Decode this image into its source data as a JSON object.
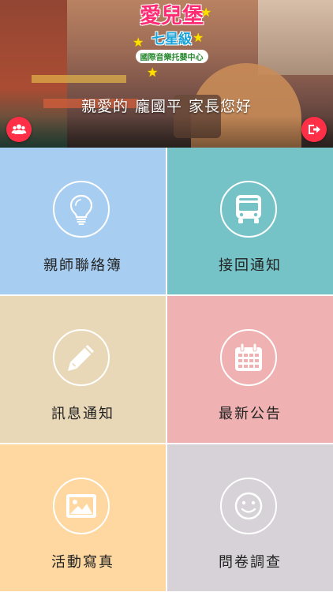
{
  "header": {
    "logo": {
      "title": "愛兒堡",
      "subtitle": "七星級",
      "tagline": "國際音樂托嬰中心"
    },
    "greeting": {
      "prefix": "親愛的",
      "name": "龐國平",
      "suffix": "家長您好"
    },
    "left_button_icon": "users-icon",
    "right_button_icon": "logout-icon"
  },
  "tiles": [
    {
      "label": "親師聯絡簿",
      "icon": "lightbulb-icon",
      "color": "#a7cdf1"
    },
    {
      "label": "接回通知",
      "icon": "bus-icon",
      "color": "#76c3c7"
    },
    {
      "label": "訊息通知",
      "icon": "pencil-icon",
      "color": "#e9d8b8"
    },
    {
      "label": "最新公告",
      "icon": "calendar-icon",
      "color": "#f0b1b2"
    },
    {
      "label": "活動寫真",
      "icon": "image-icon",
      "color": "#fed8a0"
    },
    {
      "label": "問卷調查",
      "icon": "smiley-icon",
      "color": "#d6d2d7"
    }
  ],
  "colors": {
    "accent": "#ff2f47",
    "divider": "#ffffff"
  }
}
